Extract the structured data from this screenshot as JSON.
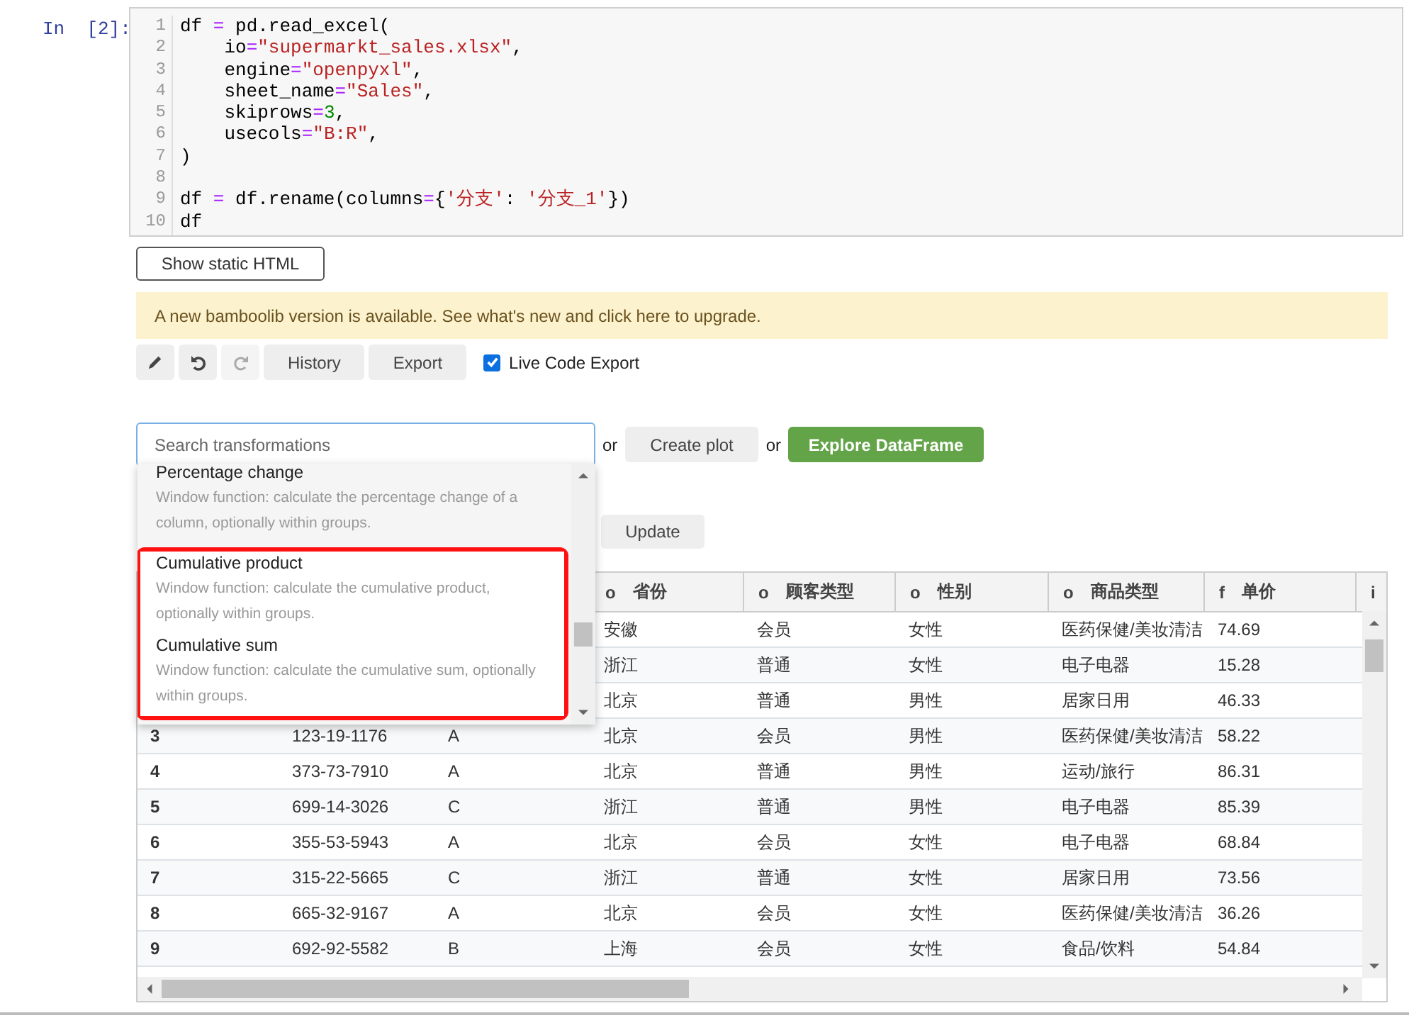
{
  "cell": {
    "prompt": "In  [2]:",
    "lines": [
      {
        "number": "1",
        "tokens": [
          {
            "text": "df ",
            "kind": "plain"
          },
          {
            "text": "=",
            "kind": "operator"
          },
          {
            "text": " pd.read_excel(",
            "kind": "plain"
          }
        ]
      },
      {
        "number": "2",
        "tokens": [
          {
            "text": "    io",
            "kind": "plain"
          },
          {
            "text": "=",
            "kind": "operator"
          },
          {
            "text": "\"supermarkt_sales.xlsx\"",
            "kind": "string"
          },
          {
            "text": ",",
            "kind": "plain"
          }
        ]
      },
      {
        "number": "3",
        "tokens": [
          {
            "text": "    engine",
            "kind": "plain"
          },
          {
            "text": "=",
            "kind": "operator"
          },
          {
            "text": "\"openpyxl\"",
            "kind": "string"
          },
          {
            "text": ",",
            "kind": "plain"
          }
        ]
      },
      {
        "number": "4",
        "tokens": [
          {
            "text": "    sheet_name",
            "kind": "plain"
          },
          {
            "text": "=",
            "kind": "operator"
          },
          {
            "text": "\"Sales\"",
            "kind": "string"
          },
          {
            "text": ",",
            "kind": "plain"
          }
        ]
      },
      {
        "number": "5",
        "tokens": [
          {
            "text": "    skiprows",
            "kind": "plain"
          },
          {
            "text": "=",
            "kind": "operator"
          },
          {
            "text": "3",
            "kind": "number"
          },
          {
            "text": ",",
            "kind": "plain"
          }
        ]
      },
      {
        "number": "6",
        "tokens": [
          {
            "text": "    usecols",
            "kind": "plain"
          },
          {
            "text": "=",
            "kind": "operator"
          },
          {
            "text": "\"B:R\"",
            "kind": "string"
          },
          {
            "text": ",",
            "kind": "plain"
          }
        ]
      },
      {
        "number": "7",
        "tokens": [
          {
            "text": ")",
            "kind": "plain"
          }
        ]
      },
      {
        "number": "8"
      },
      {
        "number": "9",
        "tokens": [
          {
            "text": "df ",
            "kind": "plain"
          },
          {
            "text": "=",
            "kind": "operator"
          },
          {
            "text": " df.rename(columns",
            "kind": "plain"
          },
          {
            "text": "=",
            "kind": "operator"
          },
          {
            "text": "{",
            "kind": "plain"
          },
          {
            "text": "'分支'",
            "kind": "string"
          },
          {
            "text": ": ",
            "kind": "plain"
          },
          {
            "text": "'分支_1'",
            "kind": "string"
          },
          {
            "text": "})",
            "kind": "plain"
          }
        ]
      },
      {
        "number": "10",
        "tokens": [
          {
            "text": "df",
            "kind": "plain"
          }
        ]
      }
    ]
  },
  "static_html_button": "Show static HTML",
  "notice": "A new bamboolib version is available. See what's new and click here to upgrade.",
  "toolbar": {
    "buttons": [
      {
        "kind": "pencil",
        "disabled": false
      },
      {
        "kind": "undo",
        "disabled": false
      },
      {
        "kind": "redo",
        "disabled": true
      },
      {
        "kind": "text",
        "label": "History"
      },
      {
        "kind": "text",
        "label": "Export"
      }
    ],
    "live_code_export": {
      "label": "Live Code Export",
      "checked": true
    }
  },
  "search": {
    "placeholder": "Search transformations"
  },
  "or_1": "or",
  "create_plot": "Create plot",
  "or_2": "or",
  "explore": "Explore DataFrame",
  "dropdown": {
    "items": [
      {
        "title": "Percentage change",
        "description": "Window function: calculate the percentage change of a column, optionally within groups.",
        "highlighted": false
      },
      {
        "title": "Cumulative product",
        "description": "Window function: calculate the cumulative product, optionally within groups.",
        "highlighted": true
      },
      {
        "title": "Cumulative sum",
        "description": "Window function: calculate the cumulative sum, optionally within groups.",
        "highlighted": true
      }
    ]
  },
  "update_button": "Update",
  "table": {
    "columns": [
      {
        "type": "o",
        "name": "省份"
      },
      {
        "type": "o",
        "name": "顾客类型"
      },
      {
        "type": "o",
        "name": "性别"
      },
      {
        "type": "o",
        "name": "商品类型"
      },
      {
        "type": "f",
        "name": "单价"
      },
      {
        "type": "i"
      }
    ],
    "rows": [
      {
        "province": "安徽",
        "customer_type": "会员",
        "gender": "女性",
        "product_type": "医药保健/美妆清洁",
        "unit_price": "74.69"
      },
      {
        "province": "浙江",
        "customer_type": "普通",
        "gender": "女性",
        "product_type": "电子电器",
        "unit_price": "15.28"
      },
      {
        "province": "北京",
        "customer_type": "普通",
        "gender": "男性",
        "product_type": "居家日用",
        "unit_price": "46.33"
      },
      {
        "index": "3",
        "invoice_id": "123-19-1176",
        "branch": "A",
        "province": "北京",
        "customer_type": "会员",
        "gender": "男性",
        "product_type": "医药保健/美妆清洁",
        "unit_price": "58.22"
      },
      {
        "index": "4",
        "invoice_id": "373-73-7910",
        "branch": "A",
        "province": "北京",
        "customer_type": "普通",
        "gender": "男性",
        "product_type": "运动/旅行",
        "unit_price": "86.31"
      },
      {
        "index": "5",
        "invoice_id": "699-14-3026",
        "branch": "C",
        "province": "浙江",
        "customer_type": "普通",
        "gender": "男性",
        "product_type": "电子电器",
        "unit_price": "85.39"
      },
      {
        "index": "6",
        "invoice_id": "355-53-5943",
        "branch": "A",
        "province": "北京",
        "customer_type": "会员",
        "gender": "女性",
        "product_type": "电子电器",
        "unit_price": "68.84"
      },
      {
        "index": "7",
        "invoice_id": "315-22-5665",
        "branch": "C",
        "province": "浙江",
        "customer_type": "普通",
        "gender": "女性",
        "product_type": "居家日用",
        "unit_price": "73.56"
      },
      {
        "index": "8",
        "invoice_id": "665-32-9167",
        "branch": "A",
        "province": "北京",
        "customer_type": "会员",
        "gender": "女性",
        "product_type": "医药保健/美妆清洁",
        "unit_price": "36.26"
      },
      {
        "index": "9",
        "invoice_id": "692-92-5582",
        "branch": "B",
        "province": "上海",
        "customer_type": "会员",
        "gender": "女性",
        "product_type": "食品/饮料",
        "unit_price": "54.84"
      }
    ]
  }
}
